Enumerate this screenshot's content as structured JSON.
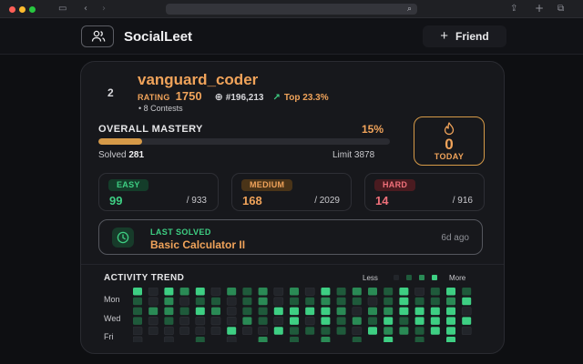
{
  "brand": {
    "name": "SocialLeet",
    "logo_icon": "users-icon"
  },
  "header": {
    "friend_button": "Friend"
  },
  "profile": {
    "rank_index": "2",
    "username": "vanguard_coder",
    "rating_label": "RATING",
    "rating": "1750",
    "global_rank": "#196,213",
    "top_percent": "Top 23.3%",
    "contests": "• 8 Contests"
  },
  "mastery": {
    "label": "OVERALL MASTERY",
    "percent_text": "15%",
    "percent": 15,
    "solved_label": "Solved",
    "solved": "281",
    "limit_text": "Limit 3878"
  },
  "streak": {
    "count": "0",
    "label": "TODAY"
  },
  "difficulty": [
    {
      "label": "EASY",
      "solved": "99",
      "total": "/ 933"
    },
    {
      "label": "MEDIUM",
      "solved": "168",
      "total": "/ 2029"
    },
    {
      "label": "HARD",
      "solved": "14",
      "total": "/ 916"
    }
  ],
  "last_solved": {
    "label": "LAST SOLVED",
    "problem": "Basic Calculator II",
    "ago": "6d ago"
  },
  "activity": {
    "title": "ACTIVITY TREND",
    "legend_less": "Less",
    "legend_more": "More",
    "days": [
      "Mon",
      "Wed",
      "Fri"
    ],
    "levels_colors": [
      "#22252a",
      "#1f5a3b",
      "#2a8a55",
      "#3ecf83"
    ],
    "grid": [
      [
        3,
        0,
        1,
        0,
        1,
        2,
        1,
        0,
        0,
        0,
        0
      ],
      [
        3,
        2,
        2,
        0,
        2,
        1,
        1,
        0,
        0,
        0,
        0
      ],
      [
        3,
        0,
        1,
        1,
        3,
        2,
        0,
        0,
        0,
        0,
        1
      ],
      [
        2,
        1,
        0,
        1,
        0,
        1,
        0,
        2,
        3,
        0,
        0
      ],
      [
        2,
        0,
        2,
        0,
        1,
        3,
        1,
        0,
        0,
        3,
        2
      ],
      [
        2,
        0,
        1,
        1,
        3,
        3,
        3,
        0,
        1,
        1,
        1
      ],
      [
        3,
        1,
        2,
        1,
        3,
        2,
        3,
        1,
        1,
        1,
        2
      ],
      [
        2,
        2,
        1,
        0,
        0,
        2,
        2,
        1,
        0,
        3,
        1
      ],
      [
        1,
        3,
        1,
        3,
        2,
        3,
        3,
        1,
        2,
        2,
        3
      ],
      [
        0,
        1,
        1,
        1,
        3,
        3,
        3,
        3,
        1,
        3,
        1
      ],
      [
        3,
        1,
        2,
        3,
        3,
        0,
        3,
        3,
        3,
        0,
        3
      ],
      [
        0,
        1,
        1,
        1,
        2,
        0,
        0,
        1,
        0,
        3,
        1
      ]
    ]
  },
  "colors": {
    "accent_orange": "#f0a35a",
    "accent_green": "#3ecf83",
    "accent_red": "#f0707a"
  }
}
